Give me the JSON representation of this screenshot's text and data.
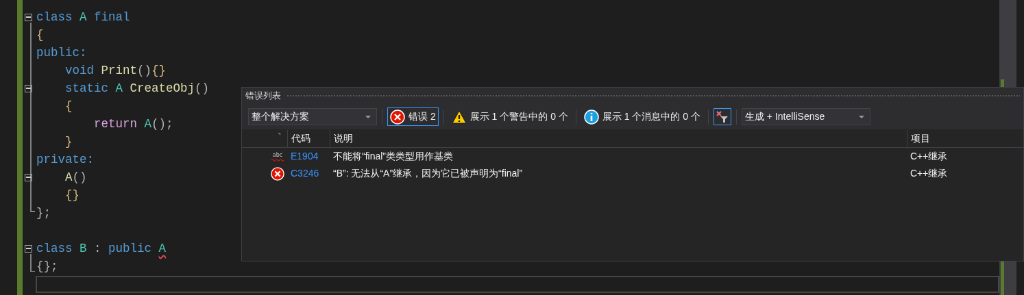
{
  "code": {
    "lines": [
      {
        "fold": true,
        "tokens": [
          {
            "text": "class ",
            "kind": "keyword"
          },
          {
            "text": "A ",
            "kind": "type"
          },
          {
            "text": "final",
            "kind": "keyword"
          }
        ]
      },
      {
        "fold": false,
        "tokens": [
          {
            "text": "{",
            "kind": "brace"
          }
        ]
      },
      {
        "fold": false,
        "tokens": [
          {
            "text": "public:",
            "kind": "keyword"
          }
        ]
      },
      {
        "fold": false,
        "tokens": [
          {
            "text": "    void ",
            "kind": "keyword"
          },
          {
            "text": "Print",
            "kind": "function"
          },
          {
            "text": "()",
            "kind": "punct"
          },
          {
            "text": "{}",
            "kind": "brace"
          }
        ]
      },
      {
        "fold": true,
        "tokens": [
          {
            "text": "    static ",
            "kind": "keyword"
          },
          {
            "text": "A ",
            "kind": "type"
          },
          {
            "text": "CreateObj",
            "kind": "function"
          },
          {
            "text": "()",
            "kind": "punct"
          }
        ]
      },
      {
        "fold": false,
        "tokens": [
          {
            "text": "    {",
            "kind": "brace"
          }
        ]
      },
      {
        "fold": false,
        "tokens": [
          {
            "text": "        return ",
            "kind": "control"
          },
          {
            "text": "A",
            "kind": "type"
          },
          {
            "text": "();",
            "kind": "punct"
          }
        ]
      },
      {
        "fold": false,
        "tokens": [
          {
            "text": "    }",
            "kind": "brace"
          }
        ]
      },
      {
        "fold": false,
        "tokens": [
          {
            "text": "private:",
            "kind": "keyword"
          }
        ]
      },
      {
        "fold": true,
        "tokens": [
          {
            "text": "    A",
            "kind": "function"
          },
          {
            "text": "()",
            "kind": "punct"
          }
        ]
      },
      {
        "fold": false,
        "tokens": [
          {
            "text": "    {}",
            "kind": "brace"
          }
        ]
      },
      {
        "fold": false,
        "tokens": [
          {
            "text": "};",
            "kind": "punct"
          }
        ]
      },
      {
        "fold": false
      },
      {
        "fold": true,
        "tokens": [
          {
            "text": "class ",
            "kind": "keyword"
          },
          {
            "text": "B ",
            "kind": "type"
          },
          {
            "text": ": ",
            "kind": "punct"
          },
          {
            "text": "public ",
            "kind": "keyword"
          },
          {
            "text": "A",
            "kind": "type",
            "squiggle": true
          }
        ]
      },
      {
        "fold": false,
        "tokens": [
          {
            "text": "{};",
            "kind": "punct"
          }
        ]
      }
    ]
  },
  "error_list": {
    "title": "错误列表",
    "scope_dropdown": {
      "value": "整个解决方案"
    },
    "filters": [
      {
        "kind": "error",
        "label": "错误 2",
        "selected": true
      },
      {
        "kind": "warning",
        "label": "展示 1 个警告中的 0 个",
        "selected": false
      },
      {
        "kind": "message",
        "label": "展示 1 个消息中的 0 个",
        "selected": false
      }
    ],
    "source_dropdown": {
      "value": "生成 + IntelliSense"
    },
    "columns": [
      "代码",
      "说明",
      "项目"
    ],
    "rows": [
      {
        "kind": "intellisense",
        "icon_label": "abc",
        "code": "E1904",
        "description": "不能将“final”类类型用作基类",
        "project": "C++继承"
      },
      {
        "kind": "error",
        "code": "C3246",
        "description": "“B”: 无法从“A”继承，因为它已被声明为“final”",
        "project": "C++继承"
      }
    ]
  }
}
